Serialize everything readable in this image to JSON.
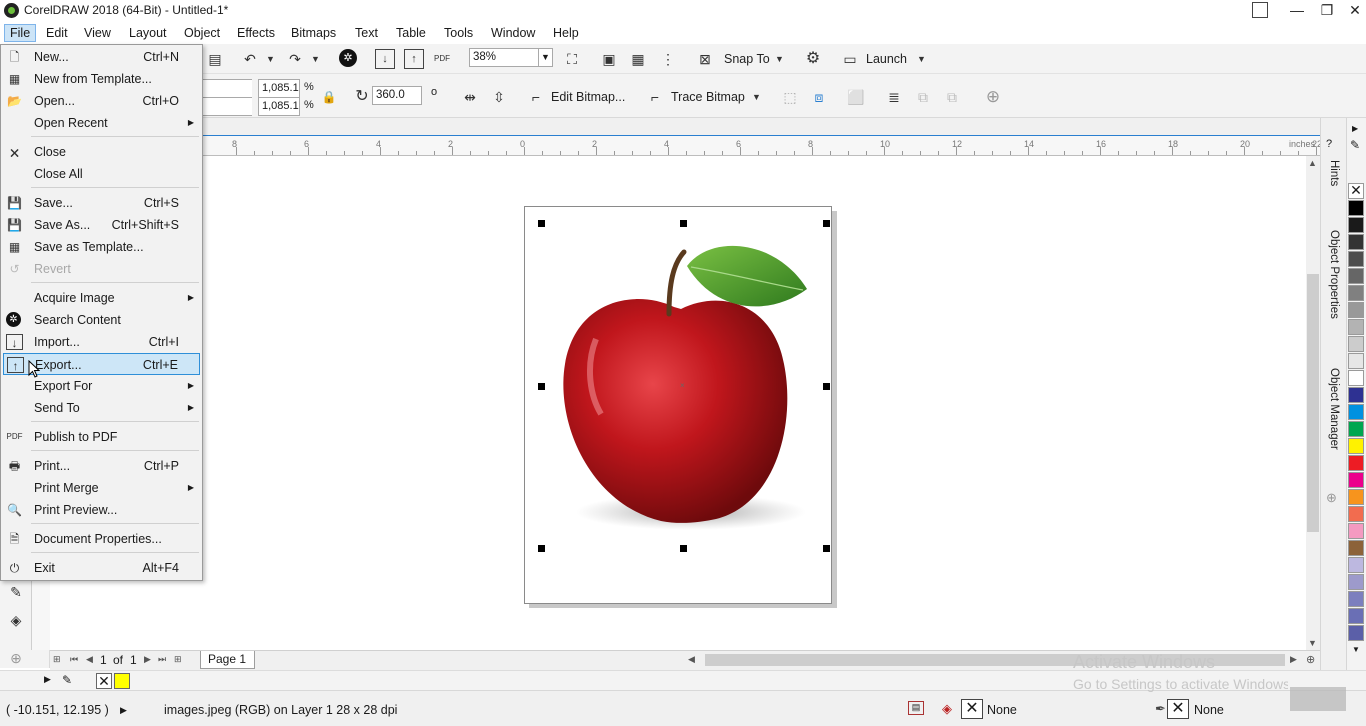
{
  "window": {
    "title": "CorelDRAW 2018 (64-Bit) - Untitled-1*",
    "minimize_glyph": "—",
    "restore_glyph": "❐",
    "close_glyph": "✕"
  },
  "menubar": [
    "File",
    "Edit",
    "View",
    "Layout",
    "Object",
    "Effects",
    "Bitmaps",
    "Text",
    "Table",
    "Tools",
    "Window",
    "Help"
  ],
  "toolbar1": {
    "zoom_value": "38%",
    "snap_to_label": "Snap To",
    "launch_label": "Launch"
  },
  "toolbar2": {
    "scale_x": "1,085.1",
    "scale_y": "1,085.1",
    "percent": "%",
    "rotation": "360.0",
    "degree": "o",
    "edit_bitmap_label": "Edit Bitmap...",
    "trace_bitmap_label": "Trace Bitmap"
  },
  "ruler": {
    "ticks": [
      "8",
      "6",
      "4",
      "2",
      "0",
      "2",
      "4",
      "6",
      "8",
      "10",
      "12",
      "14",
      "16",
      "18",
      "20",
      "22"
    ],
    "unit": "inches"
  },
  "file_menu": {
    "items": [
      {
        "label": "New...",
        "shortcut": "Ctrl+N",
        "icon": "new-document-icon"
      },
      {
        "label": "New from Template...",
        "shortcut": "",
        "icon": "new-template-icon"
      },
      {
        "label": "Open...",
        "shortcut": "Ctrl+O",
        "icon": "open-folder-icon"
      },
      {
        "label": "Open Recent",
        "shortcut": "",
        "icon": ""
      },
      {
        "label": "Close",
        "shortcut": "",
        "icon": "close-document-icon"
      },
      {
        "label": "Close All",
        "shortcut": "",
        "icon": ""
      },
      {
        "label": "Save...",
        "shortcut": "Ctrl+S",
        "icon": "save-icon"
      },
      {
        "label": "Save As...",
        "shortcut": "Ctrl+Shift+S",
        "icon": "save-as-icon"
      },
      {
        "label": "Save as Template...",
        "shortcut": "",
        "icon": "save-template-icon"
      },
      {
        "label": "Revert",
        "shortcut": "",
        "icon": "revert-icon"
      },
      {
        "label": "Acquire Image",
        "shortcut": "",
        "icon": ""
      },
      {
        "label": "Search Content",
        "shortcut": "",
        "icon": "search-content-icon"
      },
      {
        "label": "Import...",
        "shortcut": "Ctrl+I",
        "icon": "import-icon"
      },
      {
        "label": "Export...",
        "shortcut": "Ctrl+E",
        "icon": "export-icon"
      },
      {
        "label": "Export For",
        "shortcut": "",
        "icon": ""
      },
      {
        "label": "Send To",
        "shortcut": "",
        "icon": ""
      },
      {
        "label": "Publish to PDF",
        "shortcut": "",
        "icon": "pdf-icon"
      },
      {
        "label": "Print...",
        "shortcut": "Ctrl+P",
        "icon": "print-icon"
      },
      {
        "label": "Print Merge",
        "shortcut": "",
        "icon": ""
      },
      {
        "label": "Print Preview...",
        "shortcut": "",
        "icon": "print-preview-icon"
      },
      {
        "label": "Document Properties...",
        "shortcut": "",
        "icon": "document-properties-icon"
      },
      {
        "label": "Exit",
        "shortcut": "Alt+F4",
        "icon": "exit-icon"
      }
    ],
    "pdf_icon_text": "PDF"
  },
  "page_nav": {
    "current": "1",
    "of_label": "of",
    "total": "1",
    "page_tab": "Page 1"
  },
  "dockers": {
    "hints": "Hints",
    "object_properties": "Object Properties",
    "object_manager": "Object Manager"
  },
  "status": {
    "coords": "( -10.151, 12.195 )",
    "info": "images.jpeg (RGB) on Layer 1 28 x 28 dpi",
    "fill_none": "None",
    "outline_none": "None"
  },
  "watermark": {
    "line1": "Activate Windows",
    "line2": "Go to Settings to activate Windows."
  },
  "colors": {
    "selection": "#cde6f7",
    "selection_border": "#2f8fd8",
    "apple_red": "#c0161c",
    "leaf_green": "#4a9a2c"
  }
}
